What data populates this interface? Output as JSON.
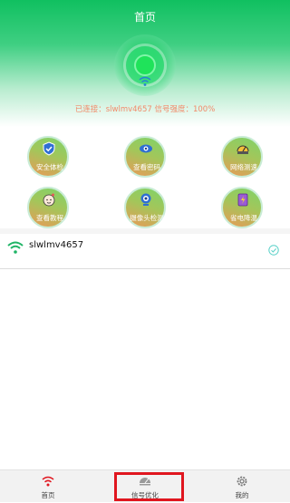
{
  "header": {
    "title": "首页"
  },
  "connection": {
    "status_text": "已连接：slwlmv4657   信号强度：100%"
  },
  "features": [
    {
      "label": "安全体检",
      "icon": "shield-icon"
    },
    {
      "label": "查看密码",
      "icon": "eye-icon"
    },
    {
      "label": "网络测速",
      "icon": "speedometer-icon"
    },
    {
      "label": "查看教程",
      "icon": "character-icon"
    },
    {
      "label": "摄像头检测",
      "icon": "camera-icon"
    },
    {
      "label": "省电降温",
      "icon": "battery-icon"
    }
  ],
  "wifi": {
    "name": "slwlmv4657"
  },
  "tabbar": {
    "tabs": [
      {
        "label": "首页",
        "icon": "wifi-icon"
      },
      {
        "label": "信号优化",
        "icon": "radar-icon"
      },
      {
        "label": "我的",
        "icon": "gear-icon"
      }
    ]
  },
  "colors": {
    "primary": "#10c060",
    "status_text": "#f28a6a",
    "highlight": "#e0161f"
  }
}
